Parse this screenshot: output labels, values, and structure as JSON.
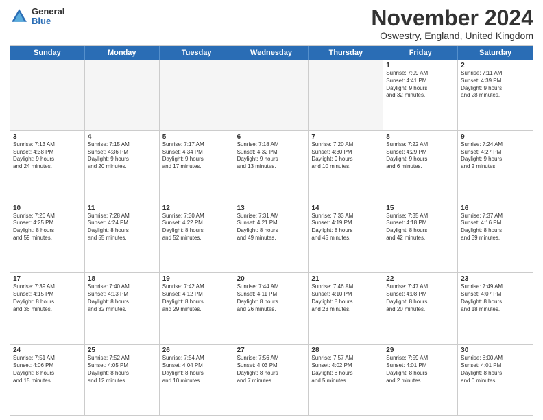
{
  "logo": {
    "general": "General",
    "blue": "Blue"
  },
  "title": "November 2024",
  "location": "Oswestry, England, United Kingdom",
  "days": [
    "Sunday",
    "Monday",
    "Tuesday",
    "Wednesday",
    "Thursday",
    "Friday",
    "Saturday"
  ],
  "weeks": [
    [
      {
        "day": "",
        "info": "",
        "empty": true
      },
      {
        "day": "",
        "info": "",
        "empty": true
      },
      {
        "day": "",
        "info": "",
        "empty": true
      },
      {
        "day": "",
        "info": "",
        "empty": true
      },
      {
        "day": "",
        "info": "",
        "empty": true
      },
      {
        "day": "1",
        "info": "Sunrise: 7:09 AM\nSunset: 4:41 PM\nDaylight: 9 hours\nand 32 minutes.",
        "empty": false
      },
      {
        "day": "2",
        "info": "Sunrise: 7:11 AM\nSunset: 4:39 PM\nDaylight: 9 hours\nand 28 minutes.",
        "empty": false
      }
    ],
    [
      {
        "day": "3",
        "info": "Sunrise: 7:13 AM\nSunset: 4:38 PM\nDaylight: 9 hours\nand 24 minutes.",
        "empty": false
      },
      {
        "day": "4",
        "info": "Sunrise: 7:15 AM\nSunset: 4:36 PM\nDaylight: 9 hours\nand 20 minutes.",
        "empty": false
      },
      {
        "day": "5",
        "info": "Sunrise: 7:17 AM\nSunset: 4:34 PM\nDaylight: 9 hours\nand 17 minutes.",
        "empty": false
      },
      {
        "day": "6",
        "info": "Sunrise: 7:18 AM\nSunset: 4:32 PM\nDaylight: 9 hours\nand 13 minutes.",
        "empty": false
      },
      {
        "day": "7",
        "info": "Sunrise: 7:20 AM\nSunset: 4:30 PM\nDaylight: 9 hours\nand 10 minutes.",
        "empty": false
      },
      {
        "day": "8",
        "info": "Sunrise: 7:22 AM\nSunset: 4:29 PM\nDaylight: 9 hours\nand 6 minutes.",
        "empty": false
      },
      {
        "day": "9",
        "info": "Sunrise: 7:24 AM\nSunset: 4:27 PM\nDaylight: 9 hours\nand 2 minutes.",
        "empty": false
      }
    ],
    [
      {
        "day": "10",
        "info": "Sunrise: 7:26 AM\nSunset: 4:25 PM\nDaylight: 8 hours\nand 59 minutes.",
        "empty": false
      },
      {
        "day": "11",
        "info": "Sunrise: 7:28 AM\nSunset: 4:24 PM\nDaylight: 8 hours\nand 55 minutes.",
        "empty": false
      },
      {
        "day": "12",
        "info": "Sunrise: 7:30 AM\nSunset: 4:22 PM\nDaylight: 8 hours\nand 52 minutes.",
        "empty": false
      },
      {
        "day": "13",
        "info": "Sunrise: 7:31 AM\nSunset: 4:21 PM\nDaylight: 8 hours\nand 49 minutes.",
        "empty": false
      },
      {
        "day": "14",
        "info": "Sunrise: 7:33 AM\nSunset: 4:19 PM\nDaylight: 8 hours\nand 45 minutes.",
        "empty": false
      },
      {
        "day": "15",
        "info": "Sunrise: 7:35 AM\nSunset: 4:18 PM\nDaylight: 8 hours\nand 42 minutes.",
        "empty": false
      },
      {
        "day": "16",
        "info": "Sunrise: 7:37 AM\nSunset: 4:16 PM\nDaylight: 8 hours\nand 39 minutes.",
        "empty": false
      }
    ],
    [
      {
        "day": "17",
        "info": "Sunrise: 7:39 AM\nSunset: 4:15 PM\nDaylight: 8 hours\nand 36 minutes.",
        "empty": false
      },
      {
        "day": "18",
        "info": "Sunrise: 7:40 AM\nSunset: 4:13 PM\nDaylight: 8 hours\nand 32 minutes.",
        "empty": false
      },
      {
        "day": "19",
        "info": "Sunrise: 7:42 AM\nSunset: 4:12 PM\nDaylight: 8 hours\nand 29 minutes.",
        "empty": false
      },
      {
        "day": "20",
        "info": "Sunrise: 7:44 AM\nSunset: 4:11 PM\nDaylight: 8 hours\nand 26 minutes.",
        "empty": false
      },
      {
        "day": "21",
        "info": "Sunrise: 7:46 AM\nSunset: 4:10 PM\nDaylight: 8 hours\nand 23 minutes.",
        "empty": false
      },
      {
        "day": "22",
        "info": "Sunrise: 7:47 AM\nSunset: 4:08 PM\nDaylight: 8 hours\nand 20 minutes.",
        "empty": false
      },
      {
        "day": "23",
        "info": "Sunrise: 7:49 AM\nSunset: 4:07 PM\nDaylight: 8 hours\nand 18 minutes.",
        "empty": false
      }
    ],
    [
      {
        "day": "24",
        "info": "Sunrise: 7:51 AM\nSunset: 4:06 PM\nDaylight: 8 hours\nand 15 minutes.",
        "empty": false
      },
      {
        "day": "25",
        "info": "Sunrise: 7:52 AM\nSunset: 4:05 PM\nDaylight: 8 hours\nand 12 minutes.",
        "empty": false
      },
      {
        "day": "26",
        "info": "Sunrise: 7:54 AM\nSunset: 4:04 PM\nDaylight: 8 hours\nand 10 minutes.",
        "empty": false
      },
      {
        "day": "27",
        "info": "Sunrise: 7:56 AM\nSunset: 4:03 PM\nDaylight: 8 hours\nand 7 minutes.",
        "empty": false
      },
      {
        "day": "28",
        "info": "Sunrise: 7:57 AM\nSunset: 4:02 PM\nDaylight: 8 hours\nand 5 minutes.",
        "empty": false
      },
      {
        "day": "29",
        "info": "Sunrise: 7:59 AM\nSunset: 4:01 PM\nDaylight: 8 hours\nand 2 minutes.",
        "empty": false
      },
      {
        "day": "30",
        "info": "Sunrise: 8:00 AM\nSunset: 4:01 PM\nDaylight: 8 hours\nand 0 minutes.",
        "empty": false
      }
    ]
  ]
}
